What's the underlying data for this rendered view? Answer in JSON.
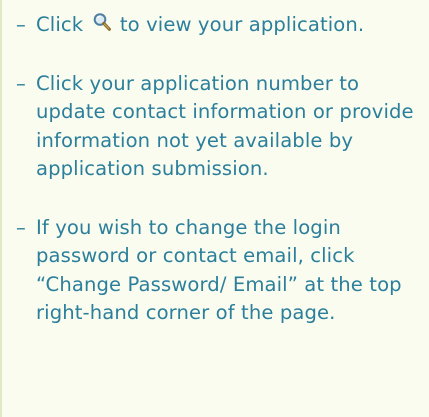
{
  "tips": {
    "dash": "–",
    "items": [
      {
        "before_icon": "Click",
        "icon": "magnifier-icon",
        "after_icon": "to view your application."
      },
      {
        "text": "Click your application number to update contact information or provide information not yet available by application submission."
      },
      {
        "text": "If you wish to change the login password or contact email, click “Change Password/ Email” at the top right-hand corner of the page."
      }
    ]
  },
  "colors": {
    "text": "#2b7f9b",
    "background": "#fafcf0",
    "border": "#dfe9c4",
    "icon_lens": "#4f7fa0",
    "icon_handle": "#8a6b2d"
  }
}
